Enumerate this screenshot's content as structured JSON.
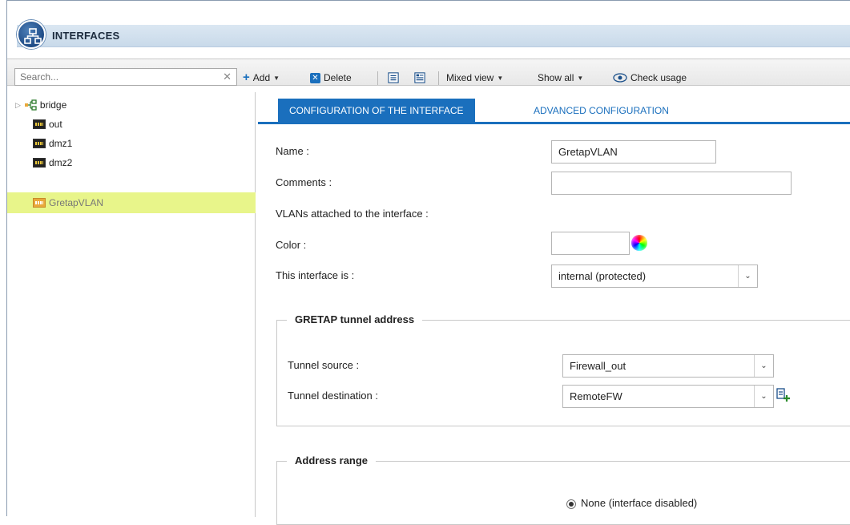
{
  "window": {
    "title": "INTERFACES"
  },
  "toolbar": {
    "search_placeholder": "Search...",
    "clear": "✕",
    "add": "Add",
    "delete": "Delete",
    "mixed_view": "Mixed view",
    "show_all": "Show all",
    "check_usage": "Check usage"
  },
  "tree": {
    "items": [
      {
        "label": "bridge",
        "icon": "bridge-icon"
      },
      {
        "label": "out",
        "icon": "network-card-icon"
      },
      {
        "label": "dmz1",
        "icon": "network-card-icon"
      },
      {
        "label": "dmz2",
        "icon": "network-card-icon"
      },
      {
        "label": "GretapVLAN",
        "icon": "gretap-icon",
        "selected": true
      }
    ]
  },
  "tabs": [
    {
      "label": "CONFIGURATION OF THE INTERFACE",
      "active": true
    },
    {
      "label": "ADVANCED CONFIGURATION",
      "active": false
    }
  ],
  "form": {
    "name_label": "Name :",
    "name_value": "GretapVLAN",
    "comments_label": "Comments :",
    "comments_value": "",
    "vlans_label": "VLANs attached to the interface :",
    "color_label": "Color :",
    "iface_is_label": "This interface is :",
    "iface_is_value": "internal (protected)"
  },
  "gretap": {
    "legend": "GRETAP tunnel address",
    "source_label": "Tunnel source :",
    "source_value": "Firewall_out",
    "dest_label": "Tunnel destination :",
    "dest_value": "RemoteFW"
  },
  "address_range": {
    "legend": "Address range",
    "option_none": "None (interface disabled)"
  },
  "colors": {
    "accent": "#1a6fbd",
    "selected_row": "#e8f58a"
  }
}
